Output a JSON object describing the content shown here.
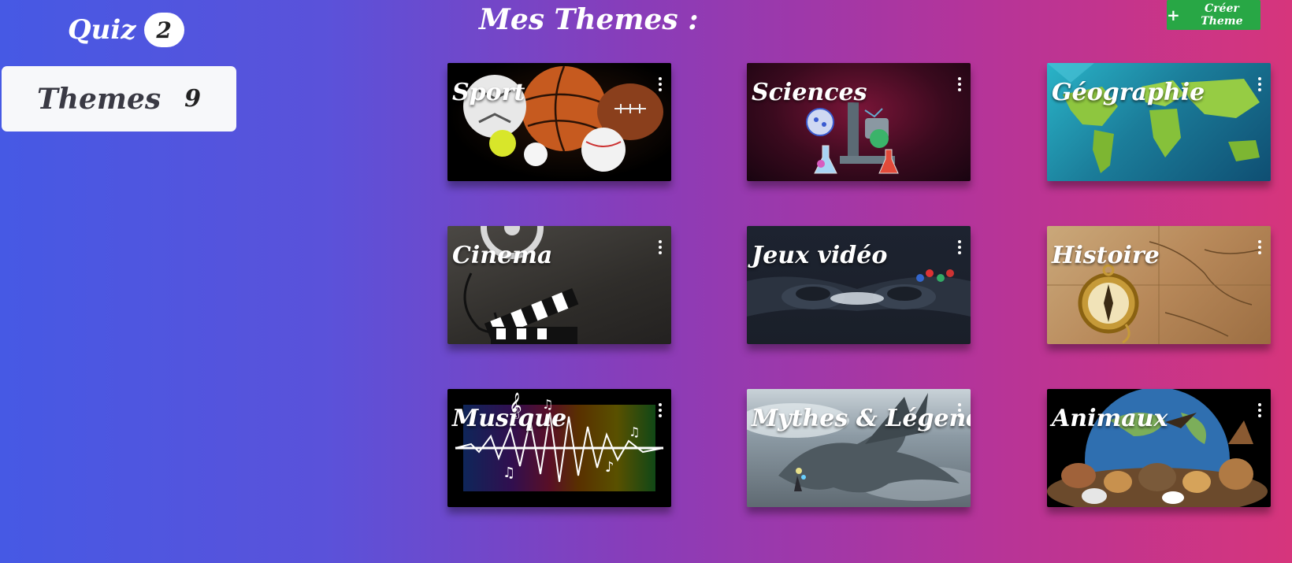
{
  "sidebar": {
    "quiz_label": "Quiz",
    "quiz_count": "2",
    "themes_label": "Themes",
    "themes_count": "9"
  },
  "header": {
    "title": "Mes Themes :",
    "create_button_label": "Créer Theme",
    "create_button_icon": "plus-icon"
  },
  "themes": [
    {
      "title": "Sport",
      "image": "sports-balls-image"
    },
    {
      "title": "Sciences",
      "image": "laboratory-equipment-image"
    },
    {
      "title": "Géographie",
      "image": "world-map-image"
    },
    {
      "title": "Cinema",
      "image": "film-reel-clapperboard-image"
    },
    {
      "title": "Jeux vidéo",
      "image": "game-controller-image"
    },
    {
      "title": "Histoire",
      "image": "antique-map-compass-image"
    },
    {
      "title": "Musique",
      "image": "sound-wave-music-notes-image"
    },
    {
      "title": "Mythes & Légendes",
      "image": "dragon-wizard-image"
    },
    {
      "title": "Animaux",
      "image": "animals-earth-image"
    }
  ],
  "colors": {
    "background_start": "#4659e4",
    "background_end": "#d6357c",
    "create_button": "#28a745",
    "themes_box": "#f7f8fa"
  }
}
